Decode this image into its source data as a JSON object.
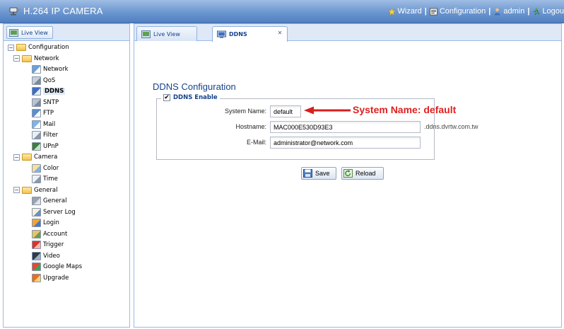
{
  "header": {
    "app_title": "H.264 IP CAMERA",
    "nav": {
      "wizard": "Wizard",
      "configuration": "Configuration",
      "admin": "admin",
      "logout": "Logou"
    }
  },
  "left_panel": {
    "tab_label": "Live View",
    "tree": [
      {
        "label": "Configuration",
        "type": "folder",
        "level": 0
      },
      {
        "label": "Network",
        "type": "folder",
        "level": 1
      },
      {
        "label": "Network",
        "type": "leaf",
        "icon": "network-icon",
        "level": 2
      },
      {
        "label": "QoS",
        "type": "leaf",
        "icon": "qos-icon",
        "level": 2
      },
      {
        "label": "DDNS",
        "type": "leaf",
        "icon": "ddns-icon",
        "level": 2,
        "selected": true
      },
      {
        "label": "SNTP",
        "type": "leaf",
        "icon": "sntp-icon",
        "level": 2
      },
      {
        "label": "FTP",
        "type": "leaf",
        "icon": "ftp-icon",
        "level": 2
      },
      {
        "label": "Mail",
        "type": "leaf",
        "icon": "mail-icon",
        "level": 2
      },
      {
        "label": "Filter",
        "type": "leaf",
        "icon": "filter-icon",
        "level": 2
      },
      {
        "label": "UPnP",
        "type": "leaf",
        "icon": "upnp-icon",
        "level": 2
      },
      {
        "label": "Camera",
        "type": "folder",
        "level": 1
      },
      {
        "label": "Color",
        "type": "leaf",
        "icon": "color-icon",
        "level": 2
      },
      {
        "label": "Time",
        "type": "leaf",
        "icon": "time-icon",
        "level": 2
      },
      {
        "label": "General",
        "type": "folder",
        "level": 1
      },
      {
        "label": "General",
        "type": "leaf",
        "icon": "general-icon",
        "level": 2
      },
      {
        "label": "Server Log",
        "type": "leaf",
        "icon": "server-log-icon",
        "level": 2
      },
      {
        "label": "Login",
        "type": "leaf",
        "icon": "login-icon",
        "level": 2
      },
      {
        "label": "Account",
        "type": "leaf",
        "icon": "account-icon",
        "level": 2
      },
      {
        "label": "Trigger",
        "type": "leaf",
        "icon": "trigger-icon",
        "level": 2
      },
      {
        "label": "Video",
        "type": "leaf",
        "icon": "video-icon",
        "level": 2
      },
      {
        "label": "Google Maps",
        "type": "leaf",
        "icon": "google-maps-icon",
        "level": 2
      },
      {
        "label": "Upgrade",
        "type": "leaf",
        "icon": "upgrade-icon",
        "level": 2
      }
    ]
  },
  "tabs": [
    {
      "label": "Live View",
      "active": false
    },
    {
      "label": "DDNS",
      "active": true
    }
  ],
  "form": {
    "title": "DDNS Configuration",
    "ddns_enable_label": "DDNS Enable",
    "ddns_enabled": true,
    "system_name_label": "System Name:",
    "system_name_value": "default",
    "hostname_label": "Hostname:",
    "hostname_value": "MAC000E530D93E3",
    "hostname_suffix": ".ddns.dvrtw.com.tw",
    "email_label": "E-Mail:",
    "email_value": "administrator@network.com",
    "save_label": "Save",
    "reload_label": "Reload"
  },
  "annotation": {
    "text": "System Name: default"
  },
  "colors": {
    "header": "#6b96cf",
    "panel_border": "#99bbe8",
    "annotation": "#e02020",
    "text_blue": "#15428b"
  }
}
